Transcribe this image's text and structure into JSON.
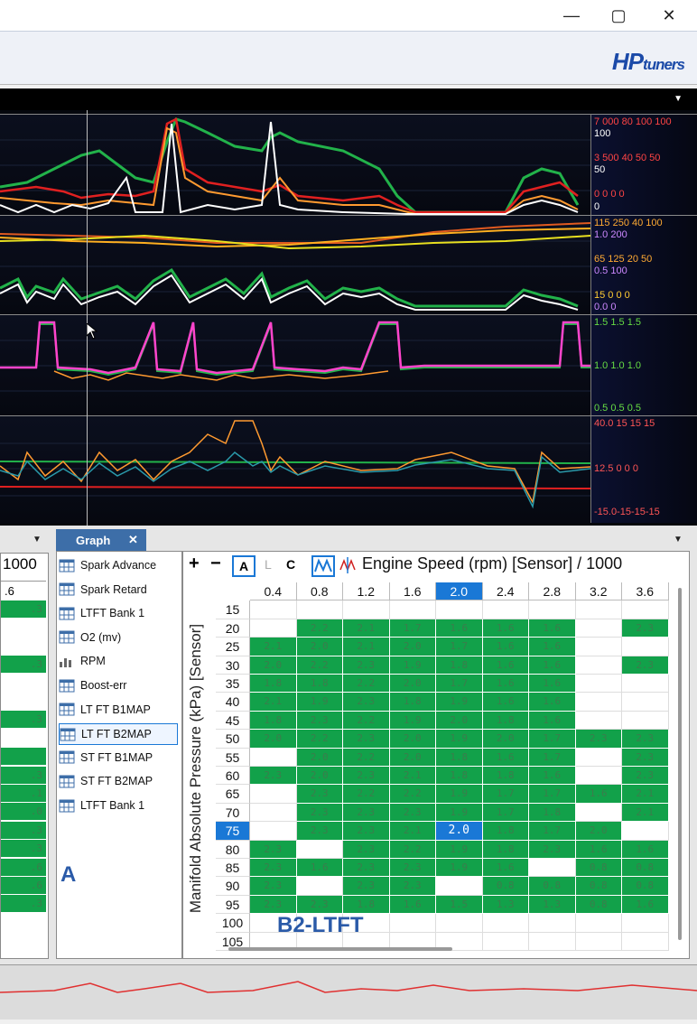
{
  "window": {
    "minimize_glyph": "—",
    "maximize_glyph": "▢",
    "close_glyph": "✕"
  },
  "logo": {
    "hp": "HP",
    "tuners": "tuners"
  },
  "graph_tab": {
    "label": "Graph",
    "close": "✕"
  },
  "panels": [
    {
      "scale_rows": [
        {
          "text": "7 000 80 100 100",
          "color": "#ff4444"
        },
        {
          "text": "100",
          "color": "#ffffff"
        },
        {
          "text": "3 500 40 50 50",
          "color": "#ff4444"
        },
        {
          "text": "50",
          "color": "#ffffff"
        },
        {
          "text": "0   0  0  0",
          "color": "#ff4444"
        },
        {
          "text": "0",
          "color": "#ffffff"
        }
      ]
    },
    {
      "scale_rows": [
        {
          "text": "115 250 40 100",
          "color": "#ffaa33"
        },
        {
          "text": "1.0 200",
          "color": "#cc88ff"
        },
        {
          "text": "65  125 20 50",
          "color": "#ffaa33"
        },
        {
          "text": "0.5 100",
          "color": "#cc88ff"
        },
        {
          "text": "15  0   0  0",
          "color": "#ffcc33"
        },
        {
          "text": "0.0 0",
          "color": "#cc88ff"
        }
      ]
    },
    {
      "scale_rows": [
        {
          "text": "1.5 1.5 1.5",
          "color": "#66dd44"
        },
        {
          "text": "1.0 1.0 1.0",
          "color": "#66dd44"
        },
        {
          "text": "0.5 0.5 0.5",
          "color": "#66dd44"
        }
      ]
    },
    {
      "scale_rows": [
        {
          "text": "40.0 15 15 15",
          "color": "#ff5555"
        },
        {
          "text": "12.5 0  0  0",
          "color": "#ff5555"
        },
        {
          "text": "-15.0-15-15-15",
          "color": "#ff5555"
        }
      ]
    }
  ],
  "left_pane": {
    "header": "1000",
    "col": ".6",
    "values": [
      ".3",
      "",
      "",
      ".3",
      "",
      "",
      ".3",
      "",
      "",
      ".3",
      ".1",
      ".0",
      ".3",
      ".3",
      ".6",
      ".6",
      ".3",
      "",
      ""
    ],
    "colors": [
      "g",
      "w",
      "w",
      "g",
      "w",
      "w",
      "g",
      "w",
      "g",
      "g",
      "g",
      "g",
      "g",
      "g",
      "g",
      "g",
      "g",
      "w",
      "w"
    ]
  },
  "list_items": [
    {
      "label": "Spark Advance",
      "icon": "table-icon"
    },
    {
      "label": "Spark Retard",
      "icon": "table-icon"
    },
    {
      "label": "LTFT Bank 1",
      "icon": "table-icon"
    },
    {
      "label": "O2 (mv)",
      "icon": "table-icon"
    },
    {
      "label": "RPM",
      "icon": "histogram-icon"
    },
    {
      "label": "Boost-err",
      "icon": "table-icon"
    },
    {
      "label": "LT FT B1MAP",
      "icon": "table-icon"
    },
    {
      "label": "LT FT B2MAP",
      "icon": "table-icon",
      "selected": true
    },
    {
      "label": "ST FT B1MAP",
      "icon": "table-icon"
    },
    {
      "label": "ST FT B2MAP",
      "icon": "table-icon"
    },
    {
      "label": "LTFT Bank 1",
      "icon": "table-icon"
    }
  ],
  "annotation_a": "A",
  "annotation_b": "B2-LTFT",
  "table": {
    "toolbar": {
      "plus": "+",
      "minus": "−",
      "a": "A",
      "l": "L",
      "c": "C"
    },
    "x_axis_title": "Engine Speed (rpm) [Sensor] / 1000",
    "y_axis_title": "Manifold Absolute Pressure (kPa) [Sensor]",
    "columns": [
      "0.4",
      "0.8",
      "1.2",
      "1.6",
      "2.0",
      "2.4",
      "2.8",
      "3.2",
      "3.6"
    ],
    "highlight_col": 4,
    "highlight_row": 12,
    "rows": [
      {
        "label": "15",
        "cells": [
          "",
          "",
          "",
          "",
          "",
          "",
          "",
          "",
          ""
        ]
      },
      {
        "label": "20",
        "cells": [
          "",
          "2.2",
          "2.1",
          "1.7",
          "1.6",
          "1.6",
          "1.6",
          "",
          "2.3"
        ]
      },
      {
        "label": "25",
        "cells": [
          "2.1",
          "2.0",
          "2.1",
          "2.0",
          "1.7",
          "1.6",
          "1.6",
          "",
          ""
        ]
      },
      {
        "label": "30",
        "cells": [
          "2.0",
          "2.2",
          "2.3",
          "1.9",
          "1.8",
          "1.6",
          "1.6",
          "",
          "2.3"
        ]
      },
      {
        "label": "35",
        "cells": [
          "1.8",
          "1.8",
          "2.2",
          "2.0",
          "1.7",
          "1.6",
          "1.6",
          "",
          ""
        ]
      },
      {
        "label": "40",
        "cells": [
          "2.1",
          "1.9",
          "2.3",
          "1.8",
          "1.9",
          "1.6",
          "1.6",
          "",
          ""
        ]
      },
      {
        "label": "45",
        "cells": [
          "1.8",
          "2.3",
          "2.2",
          "1.9",
          "2.0",
          "1.8",
          "1.6",
          "",
          ""
        ]
      },
      {
        "label": "50",
        "cells": [
          "2.0",
          "2.2",
          "2.3",
          "2.0",
          "1.9",
          "2.0",
          "1.7",
          "2.3",
          "2.3"
        ]
      },
      {
        "label": "55",
        "cells": [
          "",
          "2.0",
          "2.2",
          "2.0",
          "1.8",
          "1.6",
          "1.7",
          "",
          "2.3"
        ]
      },
      {
        "label": "60",
        "cells": [
          "2.3",
          "2.0",
          "2.3",
          "2.1",
          "1.8",
          "1.8",
          "1.6",
          "",
          "2.3"
        ]
      },
      {
        "label": "65",
        "cells": [
          "",
          "2.3",
          "2.2",
          "2.2",
          "1.9",
          "1.7",
          "1.7",
          "1.6",
          "2.1"
        ]
      },
      {
        "label": "70",
        "cells": [
          "",
          "2.3",
          "2.3",
          "2.3",
          "1.9",
          "1.7",
          "1.8",
          "",
          "2.1"
        ]
      },
      {
        "label": "75",
        "cells": [
          "",
          "2.3",
          "2.3",
          "2.1",
          "2.0",
          "1.8",
          "1.7",
          "2.0",
          ""
        ]
      },
      {
        "label": "80",
        "cells": [
          "2.3",
          "",
          "2.3",
          "2.2",
          "1.9",
          "1.8",
          "2.3",
          "1.6",
          "1.6"
        ]
      },
      {
        "label": "85",
        "cells": [
          "2.3",
          "1.6",
          "2.3",
          "2.3",
          "1.9",
          "1.6",
          "",
          "0.8",
          "0.8"
        ]
      },
      {
        "label": "90",
        "cells": [
          "2.3",
          "",
          "2.3",
          "2.3",
          "",
          "0.8",
          "0.8",
          "0.8",
          "0.8"
        ]
      },
      {
        "label": "95",
        "cells": [
          "2.3",
          "2.3",
          "1.8",
          "1.6",
          "1.5",
          "1.3",
          "1.3",
          "0.8",
          "1.6"
        ]
      },
      {
        "label": "100",
        "cells": [
          "",
          "",
          "",
          "",
          "",
          "",
          "",
          "",
          ""
        ]
      },
      {
        "label": "105",
        "cells": [
          "",
          "",
          "",
          "",
          "",
          "",
          "",
          "",
          ""
        ]
      }
    ],
    "green_mask": [
      "000000000",
      "011111101",
      "111111100",
      "111111101",
      "111111100",
      "111111100",
      "111111100",
      "111111111",
      "011111101",
      "111111101",
      "011111111",
      "011111101",
      "011111110",
      "101111111",
      "111111011",
      "101101111",
      "111111111",
      "000000000",
      "000000000"
    ]
  },
  "colors": {
    "green": "#12a14a",
    "highlight": "#1a78d6",
    "accent": "#3d6ea8"
  }
}
